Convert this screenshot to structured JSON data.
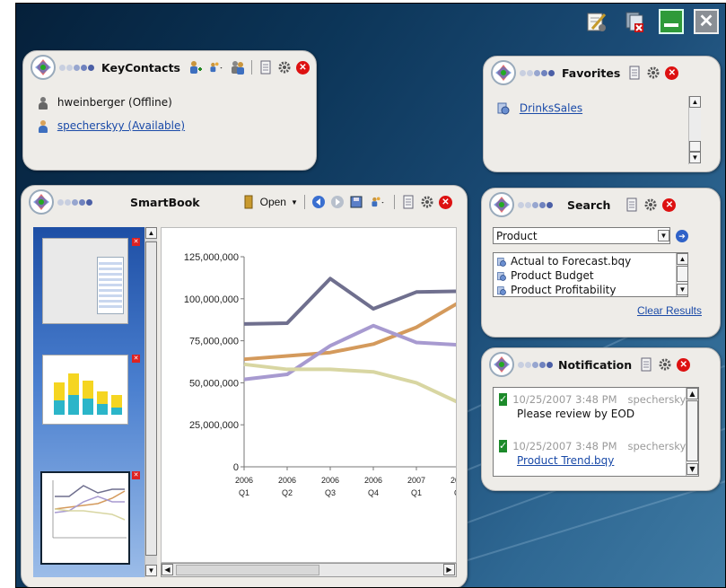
{
  "window_controls": [
    "edit-icon",
    "remove-page-icon",
    "minimize-icon",
    "close-icon"
  ],
  "key_contacts": {
    "title": "KeyContacts",
    "contacts": [
      {
        "name": "hweinberger (Offline)",
        "status": "offline",
        "link": false
      },
      {
        "name": "specherskyy (Available)",
        "status": "available",
        "link": true
      }
    ]
  },
  "favorites": {
    "title": "Favorites",
    "items": [
      "DrinksSales"
    ]
  },
  "smartbook": {
    "title": "SmartBook",
    "open_label": "Open",
    "thumbnails": [
      "thumbnail-table",
      "thumbnail-bar-chart",
      "thumbnail-line-chart"
    ]
  },
  "search": {
    "title": "Search",
    "query": "Product",
    "results": [
      "Actual to Forecast.bqy",
      "Product Budget",
      "Product Profitability"
    ],
    "clear_label": "Clear Results"
  },
  "notification": {
    "title": "Notification",
    "items": [
      {
        "time": "10/25/2007 3:48 PM",
        "sender": "specherskyy@",
        "message": "Please review by EOD",
        "is_link": false
      },
      {
        "time": "10/25/2007 3:48 PM",
        "sender": "specherskyy@",
        "message": "Product Trend.bqy",
        "is_link": true
      }
    ]
  },
  "chart_data": {
    "type": "line",
    "categories": [
      {
        "year": "2006",
        "quarter": "Q1"
      },
      {
        "year": "2006",
        "quarter": "Q2"
      },
      {
        "year": "2006",
        "quarter": "Q3"
      },
      {
        "year": "2006",
        "quarter": "Q4"
      },
      {
        "year": "2007",
        "quarter": "Q1"
      },
      {
        "year": "2007",
        "quarter": "Q2"
      }
    ],
    "yticks": [
      "125,000,000",
      "100,000,000",
      "75,000,000",
      "50,000,000",
      "25,000,000",
      "0"
    ],
    "ylim": [
      0,
      125000000
    ],
    "series": [
      {
        "color": "#6f6f8e",
        "values": [
          85000000,
          85500000,
          112000000,
          94000000,
          104000000,
          104500000
        ]
      },
      {
        "color": "#d49a5c",
        "values": [
          64000000,
          66000000,
          68000000,
          73000000,
          83000000,
          98000000
        ]
      },
      {
        "color": "#a79ad0",
        "values": [
          52000000,
          55000000,
          72000000,
          84000000,
          74000000,
          72500000
        ]
      },
      {
        "color": "#d8d6a2",
        "values": [
          61000000,
          58000000,
          58000000,
          56500000,
          50000000,
          38000000
        ]
      }
    ],
    "x_labels_visible": 6,
    "grid": false
  },
  "colors": {
    "accent_link": "#1a4aa8",
    "close_red": "#dd1111",
    "desktop_blue": "#0c3558"
  }
}
